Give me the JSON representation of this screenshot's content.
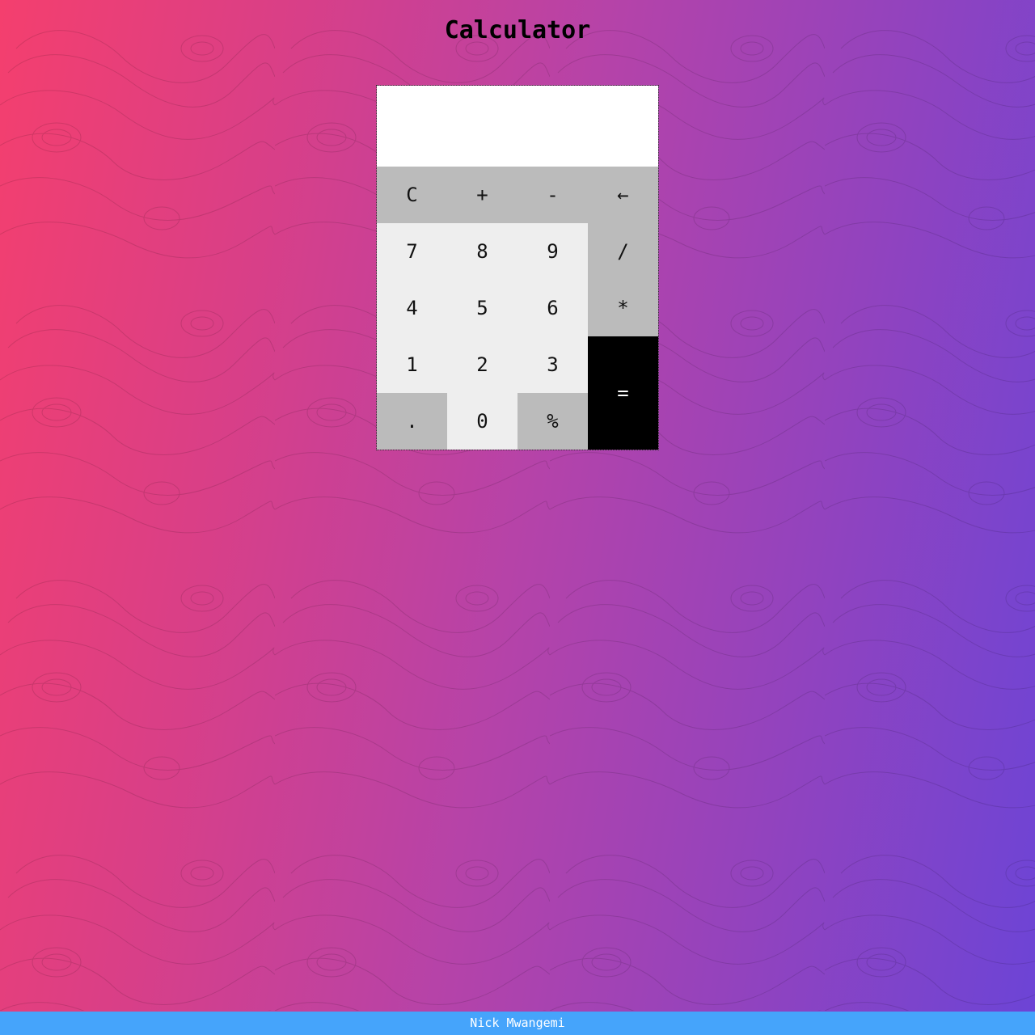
{
  "page": {
    "title": "Calculator"
  },
  "display": {
    "value": ""
  },
  "keys": {
    "clear": "C",
    "plus": "+",
    "minus": "-",
    "backspace": "←",
    "seven": "7",
    "eight": "8",
    "nine": "9",
    "divide": "/",
    "four": "4",
    "five": "5",
    "six": "6",
    "multiply": "*",
    "one": "1",
    "two": "2",
    "three": "3",
    "equals": "=",
    "decimal": ".",
    "zero": "0",
    "percent": "%"
  },
  "footer": {
    "author": "Nick Mwangemi"
  },
  "colors": {
    "background_gradient": [
      "#f43f6e",
      "#b643a8",
      "#6c44d6"
    ],
    "key_light": "#eeeeee",
    "key_dark": "#bbbbbb",
    "key_equals": "#000000",
    "footer": "#45a4fb"
  }
}
